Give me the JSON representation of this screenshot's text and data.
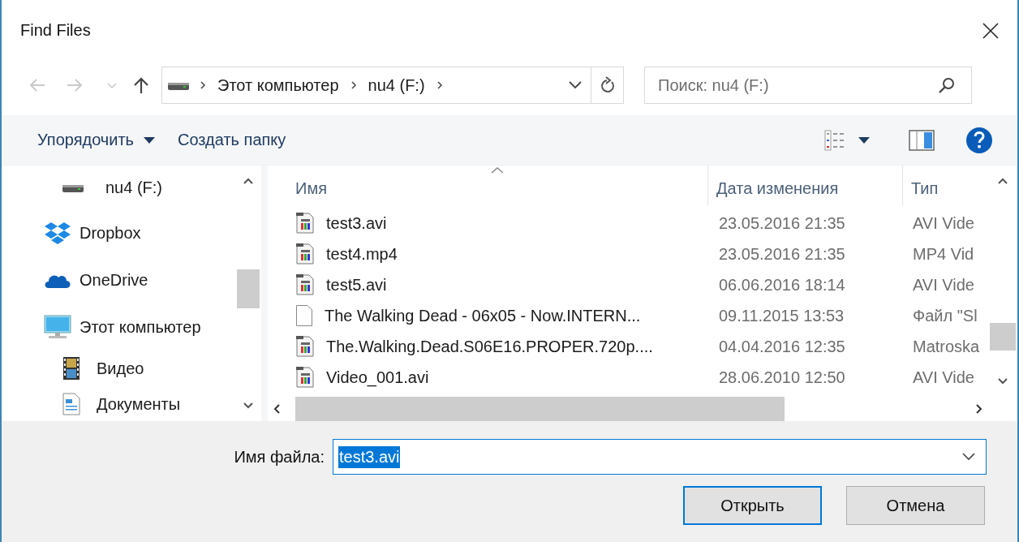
{
  "window": {
    "title": "Find Files"
  },
  "nav_buttons": [
    {
      "kind": "back",
      "disabled": true
    },
    {
      "kind": "forward",
      "disabled": true
    },
    {
      "kind": "recent",
      "disabled": true
    },
    {
      "kind": "up",
      "disabled": false
    }
  ],
  "address": {
    "segments": [
      "Этот компьютер",
      "nu4 (F:)"
    ]
  },
  "search": {
    "placeholder": "Поиск: nu4 (F:)"
  },
  "toolbar": {
    "organize": "Упорядочить",
    "new_folder": "Создать папку"
  },
  "sidebar": {
    "items": [
      {
        "kind": "drive",
        "label": "nu4 (F:)"
      },
      {
        "kind": "dropbox",
        "label": "Dropbox"
      },
      {
        "kind": "cloud",
        "label": "OneDrive"
      },
      {
        "kind": "computer",
        "label": "Этот компьютер",
        "children": [
          {
            "kind": "video",
            "label": "Видео"
          },
          {
            "kind": "documents",
            "label": "Документы"
          }
        ]
      }
    ]
  },
  "file_list": {
    "columns": [
      {
        "label": "Имя",
        "sorted": true
      },
      {
        "label": "Дата изменения",
        "sorted": false
      },
      {
        "label": "Тип",
        "sorted": false
      }
    ],
    "rows": [
      {
        "kind": "video",
        "name": "test3.avi",
        "date": "23.05.2016 21:35",
        "type": "AVI Vide"
      },
      {
        "kind": "video",
        "name": "test4.mp4",
        "date": "23.05.2016 21:35",
        "type": "MP4 Vid"
      },
      {
        "kind": "video",
        "name": "test5.avi",
        "date": "06.06.2016 18:14",
        "type": "AVI Vide"
      },
      {
        "kind": "blank",
        "name": "The Walking Dead - 06x05 - Now.INTERN...",
        "date": "09.11.2015 13:53",
        "type": "Файл \"Sl"
      },
      {
        "kind": "video",
        "name": "The.Walking.Dead.S06E16.PROPER.720p....",
        "date": "04.04.2016 12:35",
        "type": "Matroska"
      },
      {
        "kind": "video",
        "name": "Video_001.avi",
        "date": "28.06.2010 12:50",
        "type": "AVI Vide"
      }
    ]
  },
  "file_name": {
    "label": "Имя файла:",
    "value": "test3.avi",
    "highlighted": true
  },
  "buttons": [
    {
      "label": "Открыть",
      "default": true
    },
    {
      "label": "Отмена",
      "default": false
    }
  ]
}
